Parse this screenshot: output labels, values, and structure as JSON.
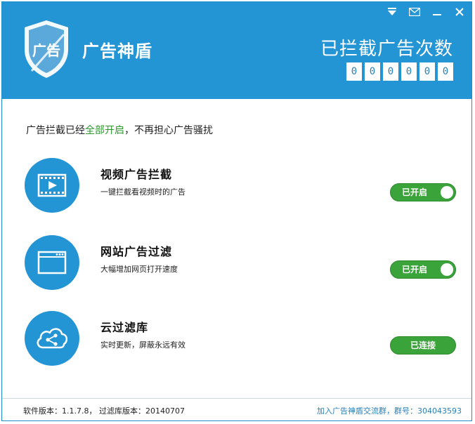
{
  "header": {
    "app_title": "广告神盾",
    "logo_text": "广告",
    "counter_title": "已拦截广告次数",
    "counter_digits": [
      "0",
      "0",
      "0",
      "0",
      "0",
      "0"
    ],
    "background_color": "#2394d4"
  },
  "window_controls": {
    "items": [
      "menu-icon",
      "mail-icon",
      "minimize-icon",
      "close-icon"
    ]
  },
  "status": {
    "prefix": "广告拦截已经",
    "highlight": "全部开启",
    "suffix": "，不再担心广告骚扰",
    "highlight_color": "#2a9a2a"
  },
  "features": [
    {
      "title": "视频广告拦截",
      "desc": "一键拦截看视频时的广告",
      "button": "已开启",
      "icon": "video-icon",
      "state": "on"
    },
    {
      "title": "网站广告过滤",
      "desc": "大幅增加网页打开速度",
      "button": "已开启",
      "icon": "browser-window-icon",
      "state": "on"
    },
    {
      "title": "云过滤库",
      "desc": "实时更新，屏蔽永远有效",
      "button": "已连接",
      "icon": "cloud-share-icon",
      "state": "connected"
    }
  ],
  "footer": {
    "version_text": "软件版本：1.1.7.8， 过滤库版本：20140707",
    "group_text": "加入广告神盾交流群，群号：304043593"
  },
  "colors": {
    "accent": "#2394d4",
    "toggle_green": "#3aa33a",
    "link": "#2a7fb8"
  }
}
